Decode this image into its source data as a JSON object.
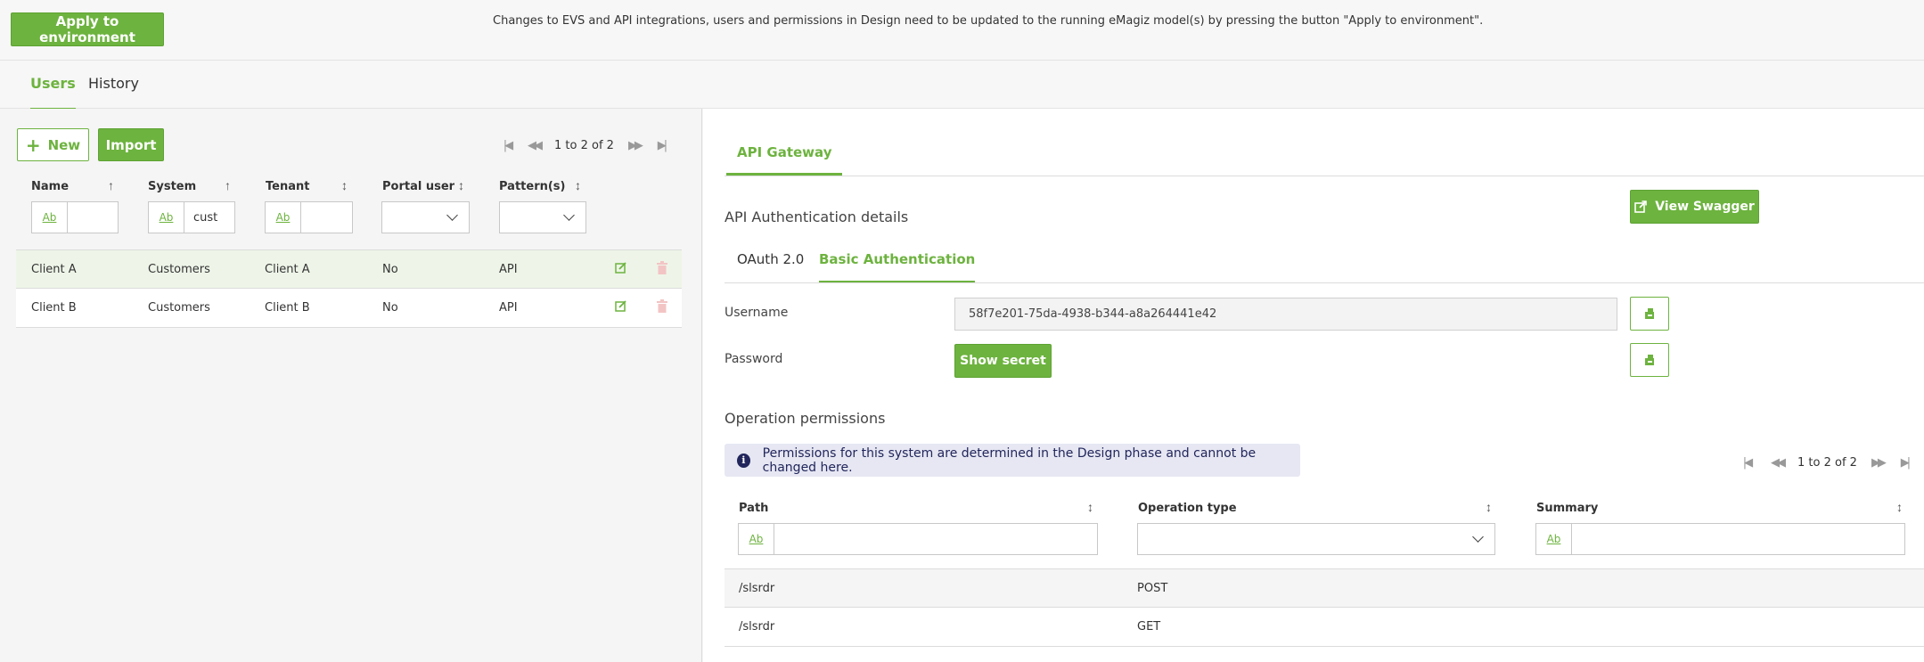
{
  "topbar": {
    "apply_label": "Apply to environment",
    "message": "Changes to EVS and API integrations, users and permissions in Design need to be updated to the running eMagiz model(s) by pressing the button \"Apply to environment\"."
  },
  "main_tabs": [
    {
      "label": "Users",
      "active": true
    },
    {
      "label": "History",
      "active": false
    }
  ],
  "users": {
    "new_label": "New",
    "import_label": "Import",
    "pager_text": "1 to 2 of 2",
    "columns": [
      "Name",
      "System",
      "Tenant",
      "Portal user",
      "Pattern(s)"
    ],
    "filter_ab": "Ab",
    "system_filter_value": "cust",
    "rows": [
      {
        "name": "Client A",
        "system": "Customers",
        "tenant": "Client A",
        "portal_user": "No",
        "patterns": "API",
        "selected": true
      },
      {
        "name": "Client B",
        "system": "Customers",
        "tenant": "Client B",
        "portal_user": "No",
        "patterns": "API",
        "selected": false
      }
    ]
  },
  "detail": {
    "gateway_tab": "API Gateway",
    "swagger_label": "View Swagger",
    "auth_title": "API Authentication details",
    "auth_tabs": [
      {
        "label": "OAuth 2.0",
        "active": false
      },
      {
        "label": "Basic Authentication",
        "active": true
      }
    ],
    "username_label": "Username",
    "username_value": "58f7e201-75da-4938-b344-a8a264441e42",
    "password_label": "Password",
    "show_secret_label": "Show secret",
    "op_title": "Operation permissions",
    "info_text": "Permissions for this system are determined in the Design phase and cannot be changed here.",
    "info_icon": "i",
    "pager_text": "1 to 2 of 2",
    "columns": [
      "Path",
      "Operation type",
      "Summary"
    ],
    "filter_ab": "Ab",
    "rows": [
      {
        "path": "/slsrdr",
        "op_type": "POST",
        "summary": ""
      },
      {
        "path": "/slsrdr",
        "op_type": "GET",
        "summary": ""
      }
    ]
  },
  "colors": {
    "accent": "#6db33f",
    "info_bg": "#e6e7f2",
    "info_text": "#22265c"
  }
}
